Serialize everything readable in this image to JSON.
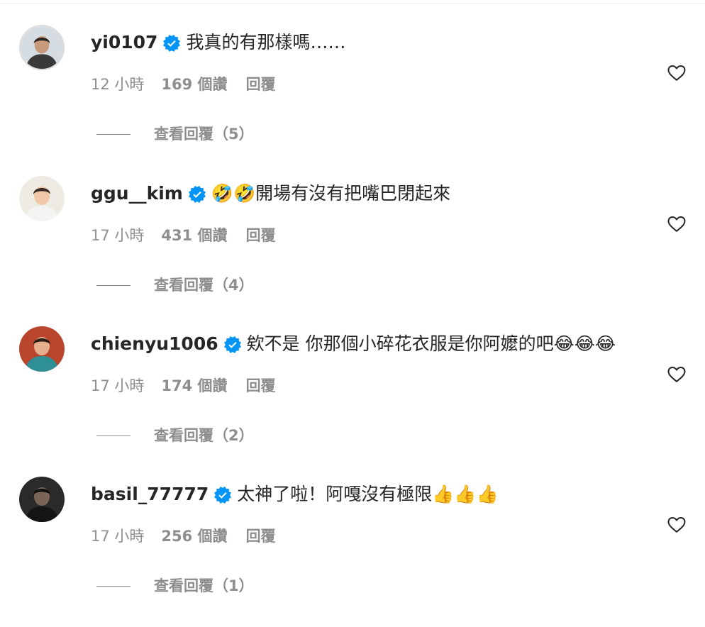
{
  "comments": [
    {
      "username": "yi0107",
      "text": "我真的有那樣嗎……",
      "time": "12 小時",
      "likes": "169 個讚",
      "reply_label": "回覆",
      "view_replies": "查看回覆（5）",
      "avatar": {
        "bg": "#d6dde2",
        "skin": "#c89a7c",
        "hair": "#2b2522",
        "shirt": "#3a3a3a"
      }
    },
    {
      "username": "ggu__kim",
      "text": "🤣🤣開場有沒有把嘴巴閉起來",
      "time": "17 小時",
      "likes": "431 個讚",
      "reply_label": "回覆",
      "view_replies": "查看回覆（4）",
      "avatar": {
        "bg": "#eeeae4",
        "skin": "#f0c8a8",
        "hair": "#3a2a22",
        "shirt": "#f4f4f2"
      }
    },
    {
      "username": "chienyu1006",
      "text": "欸不是 你那個小碎花衣服是你阿嬤的吧😂😂😂",
      "time": "17 小時",
      "likes": "174 個讚",
      "reply_label": "回覆",
      "view_replies": "查看回覆（2）",
      "avatar": {
        "bg": "#b8452c",
        "skin": "#e6b08e",
        "hair": "#2a1c16",
        "shirt": "#2e8f95"
      }
    },
    {
      "username": "basil_77777",
      "text": "太神了啦！阿嘎沒有極限👍👍👍",
      "time": "17 小時",
      "likes": "256 個讚",
      "reply_label": "回覆",
      "view_replies": "查看回覆（1）",
      "avatar": {
        "bg": "#2a2a2a",
        "skin": "#7a6458",
        "hair": "#0e0e0e",
        "shirt": "#151515"
      }
    }
  ],
  "icons": {
    "verified": "verified-badge-icon",
    "like": "heart-outline-icon"
  },
  "colors": {
    "text": "#262626",
    "secondary": "#8e8e8e",
    "verified": "#0095f6",
    "divider": "#efefef"
  }
}
